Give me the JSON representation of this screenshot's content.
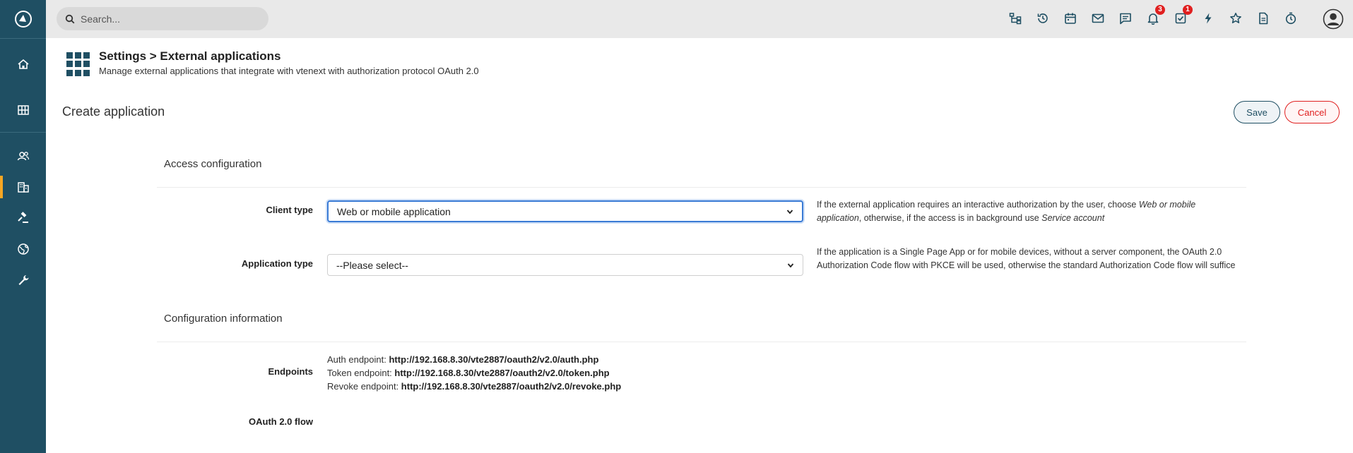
{
  "search": {
    "placeholder": "Search..."
  },
  "header": {
    "title": "Settings > External applications",
    "subtitle": "Manage external applications that integrate with vtenext with authorization protocol OAuth 2.0"
  },
  "page": {
    "title": "Create application",
    "save_label": "Save",
    "cancel_label": "Cancel"
  },
  "top_icons": [
    {
      "icon": "hierarchy-icon"
    },
    {
      "icon": "history-icon"
    },
    {
      "icon": "calendar-icon"
    },
    {
      "icon": "mail-icon"
    },
    {
      "icon": "chat-icon"
    },
    {
      "icon": "bell-icon",
      "badge": "3"
    },
    {
      "icon": "task-check-icon",
      "badge": "1"
    },
    {
      "icon": "lightning-icon"
    },
    {
      "icon": "star-icon"
    },
    {
      "icon": "document-icon"
    },
    {
      "icon": "timer-icon"
    }
  ],
  "sidebar": {
    "items": [
      {
        "icon": "home-icon"
      },
      {
        "icon": "grid-icon"
      },
      {
        "icon": "users-icon"
      },
      {
        "icon": "building-icon",
        "active": true
      },
      {
        "icon": "gavel-icon"
      },
      {
        "icon": "globe-icon"
      },
      {
        "icon": "wrench-icon"
      }
    ]
  },
  "access": {
    "title": "Access configuration",
    "client_type": {
      "label": "Client type",
      "value": "Web or mobile application",
      "help_pre": "If the external application requires an interactive authorization by the user, choose ",
      "help_em1": "Web or mobile application",
      "help_mid": ", otherwise, if the access is in background use ",
      "help_em2": "Service account"
    },
    "application_type": {
      "label": "Application type",
      "value": "--Please select--",
      "help": "If the application is a Single Page App or for mobile devices, without a server component, the OAuth 2.0 Authorization Code flow with PKCE will be used, otherwise the standard Authorization Code flow will suffice"
    }
  },
  "config": {
    "title": "Configuration information",
    "endpoints_label": "Endpoints",
    "auth_label": "Auth endpoint: ",
    "auth_url": "http://192.168.8.30/vte2887/oauth2/v2.0/auth.php",
    "token_label": "Token endpoint: ",
    "token_url": "http://192.168.8.30/vte2887/oauth2/v2.0/token.php",
    "revoke_label": "Revoke endpoint: ",
    "revoke_url": "http://192.168.8.30/vte2887/oauth2/v2.0/revoke.php",
    "flow_label": "OAuth 2.0 flow"
  }
}
